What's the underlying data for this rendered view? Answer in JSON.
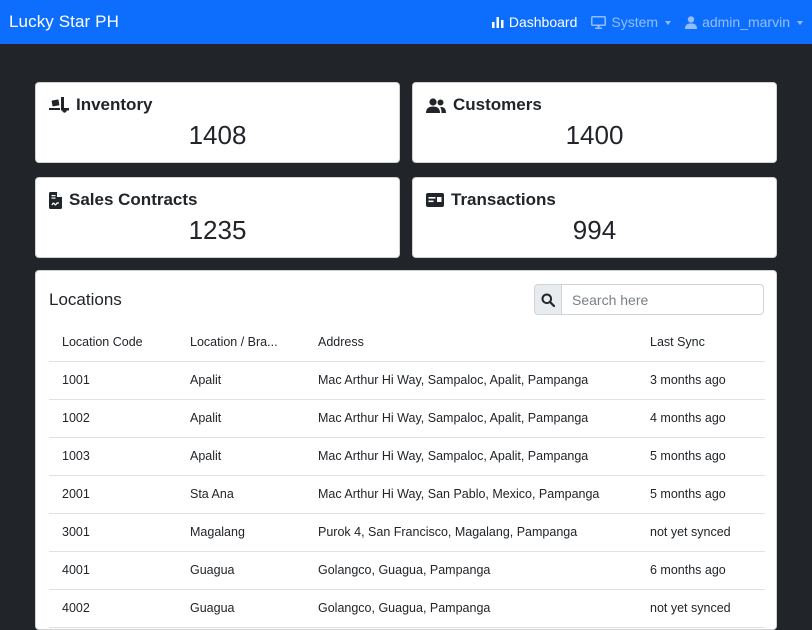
{
  "navbar": {
    "brand": "Lucky Star PH",
    "dashboard_label": "Dashboard",
    "system_label": "System",
    "user_label": "admin_marvin"
  },
  "stats": {
    "inventory": {
      "label": "Inventory",
      "value": "1408"
    },
    "customers": {
      "label": "Customers",
      "value": "1400"
    },
    "contracts": {
      "label": "Sales Contracts",
      "value": "1235"
    },
    "transactions": {
      "label": "Transactions",
      "value": "994"
    }
  },
  "locations": {
    "title": "Locations",
    "search_placeholder": "Search here",
    "columns": [
      "Location Code",
      "Location / Bra...",
      "Address",
      "Last Sync"
    ],
    "rows": [
      [
        "1001",
        "Apalit",
        "Mac Arthur Hi Way, Sampaloc, Apalit, Pampanga",
        "3 months ago"
      ],
      [
        "1002",
        "Apalit",
        "Mac Arthur Hi Way, Sampaloc, Apalit, Pampanga",
        "4 months ago"
      ],
      [
        "1003",
        "Apalit",
        "Mac Arthur Hi Way, Sampaloc, Apalit, Pampanga",
        "5 months ago"
      ],
      [
        "2001",
        "Sta Ana",
        "Mac Arthur Hi Way, San Pablo, Mexico, Pampanga",
        "5 months ago"
      ],
      [
        "3001",
        "Magalang",
        "Purok 4, San Francisco, Magalang, Pampanga",
        "not yet synced"
      ],
      [
        "4001",
        "Guagua",
        "Golangco, Guagua, Pampanga",
        "6 months ago"
      ],
      [
        "4002",
        "Guagua",
        "Golangco, Guagua, Pampanga",
        "not yet synced"
      ]
    ]
  },
  "colors": {
    "navbar": "#0d6efd",
    "background": "#212529",
    "card": "#ffffff"
  }
}
